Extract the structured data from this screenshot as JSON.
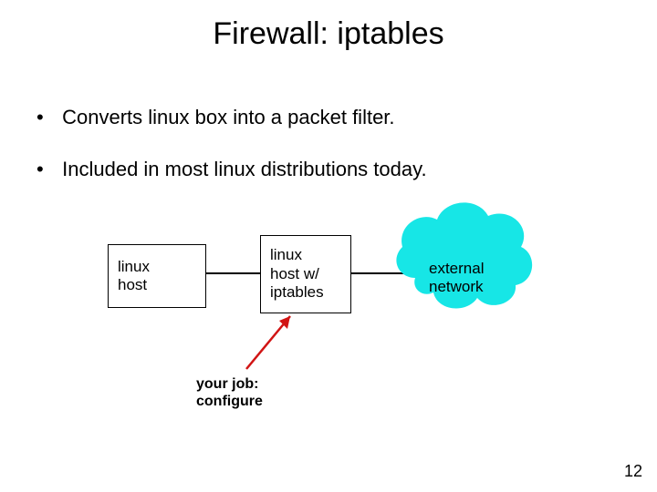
{
  "title": "Firewall: iptables",
  "bullets": [
    "Converts linux box into a packet filter.",
    "Included in most linux distributions today."
  ],
  "boxes": {
    "left": "linux\nhost",
    "mid": "linux\nhost w/\niptables",
    "cloud": "external\nnetwork"
  },
  "caption": "your job:\nconfigure",
  "slide_number": "12",
  "colors": {
    "cloud_fill": "#17e6e6",
    "arrow": "#d11414"
  }
}
